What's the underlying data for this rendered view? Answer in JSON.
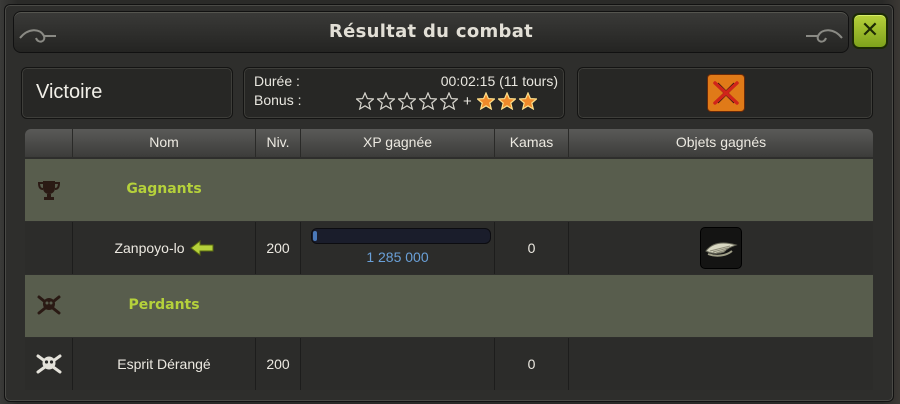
{
  "window": {
    "title": "Résultat du combat"
  },
  "summary": {
    "result": "Victoire",
    "duration_label": "Durée :",
    "duration_value": "00:02:15 (11 tours)",
    "bonus_label": "Bonus :",
    "bonus_plus": "+",
    "empty_stars": 5,
    "bonus_stars": 3
  },
  "table": {
    "headers": [
      "Nom",
      "Niv.",
      "XP gagnée",
      "Kamas",
      "Objets gagnés"
    ],
    "winners": {
      "label": "Gagnants",
      "rows": [
        {
          "name": "Zanpoyo-lo",
          "level": "200",
          "xp": "1 285 000",
          "xp_progress": 0.01,
          "kamas": "0",
          "item_icon": "wing-loot-icon",
          "is_self": true
        }
      ]
    },
    "losers": {
      "label": "Perdants",
      "rows": [
        {
          "name": "Esprit Dérangé",
          "level": "200",
          "xp": "",
          "kamas": "0",
          "item_icon": ""
        }
      ]
    }
  },
  "colors": {
    "accent_green": "#b5d13b",
    "group_row": "#585d4d",
    "xp_text": "#6aa0d8"
  },
  "icons": {
    "close": "close-icon",
    "challenge": "crossed-swords-forbidden-icon",
    "winners": "trophy-icon",
    "losers": "skull-crossbones-icon",
    "self_marker": "arrow-left-icon"
  }
}
